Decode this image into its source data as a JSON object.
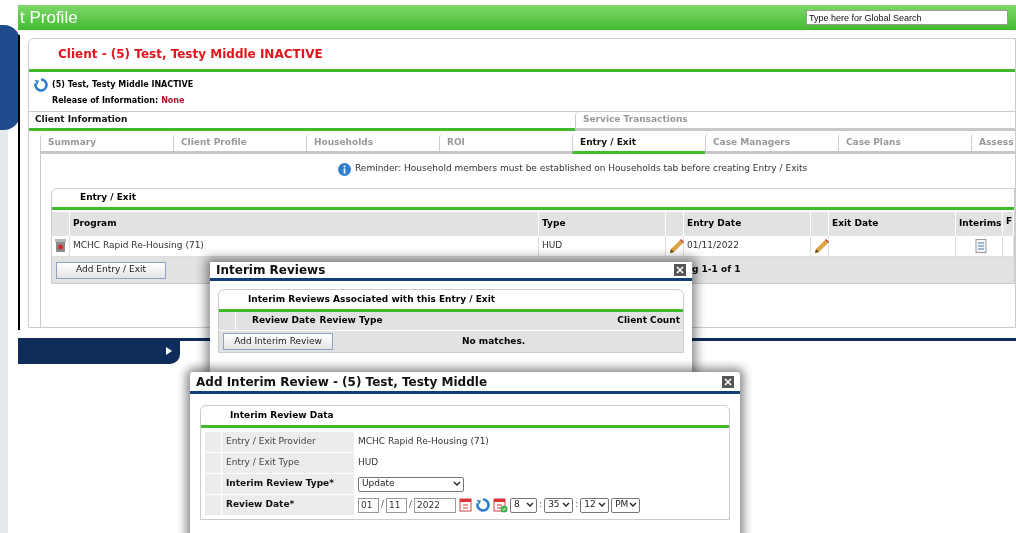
{
  "page_title": "t Profile",
  "global_search": {
    "placeholder": "Type here for Global Search"
  },
  "client_header": "Client - (5) Test, Testy Middle INACTIVE",
  "client_name": "(5) Test, Testy Middle INACTIVE",
  "release_of_information": {
    "label": "Release of Information:",
    "value": "None"
  },
  "section_tabs": [
    {
      "label": "Client Information",
      "selected": true
    },
    {
      "label": "Service Transactions",
      "selected": false
    }
  ],
  "sub_tabs": [
    {
      "label": "Summary",
      "selected": false
    },
    {
      "label": "Client Profile",
      "selected": false
    },
    {
      "label": "Households",
      "selected": false
    },
    {
      "label": "ROI",
      "selected": false
    },
    {
      "label": "Entry / Exit",
      "selected": true
    },
    {
      "label": "Case Managers",
      "selected": false
    },
    {
      "label": "Case Plans",
      "selected": false
    },
    {
      "label": "Assess",
      "selected": false
    }
  ],
  "reminder": "Reminder: Household members must be established on Households tab before creating Entry / Exits",
  "entry_exit": {
    "title": "Entry / Exit",
    "columns": [
      "Program",
      "Type",
      "Entry Date",
      "Exit Date",
      "Interims",
      "F"
    ],
    "rows": [
      {
        "program": "MCHC Rapid Re-Housing (71)",
        "type": "HUD",
        "entry_date": "01/11/2022",
        "exit_date": ""
      }
    ],
    "add_button": "Add Entry / Exit",
    "pager": "g 1-1 of 1"
  },
  "interim_reviews_dialog": {
    "title": "Interim Reviews",
    "section_title": "Interim Reviews Associated with this Entry / Exit",
    "columns": [
      "Review Date",
      "Review Type",
      "Client Count"
    ],
    "add_button": "Add Interim Review",
    "empty_text": "No matches."
  },
  "add_interim_review_dialog": {
    "title": "Add Interim Review - (5) Test, Testy Middle",
    "section_title": "Interim Review Data",
    "fields": [
      {
        "kind": "text",
        "label": "Entry / Exit Provider",
        "required": false,
        "value": "MCHC Rapid Re-Housing (71)"
      },
      {
        "kind": "text",
        "label": "Entry / Exit Type",
        "required": false,
        "value": "HUD"
      },
      {
        "kind": "select",
        "label": "Interim Review Type*",
        "required": true,
        "value": "Update"
      },
      {
        "kind": "datetime",
        "label": "Review Date*",
        "required": true,
        "parts": [
          {
            "kind": "input",
            "value": "01"
          },
          {
            "kind": "sep",
            "value": "/"
          },
          {
            "kind": "input",
            "value": "11"
          },
          {
            "kind": "sep",
            "value": "/"
          },
          {
            "kind": "input",
            "value": "2022"
          },
          {
            "kind": "calendar"
          },
          {
            "kind": "refresh"
          },
          {
            "kind": "calendar-check"
          },
          {
            "kind": "select",
            "value": "8"
          },
          {
            "kind": "sep",
            "value": ":"
          },
          {
            "kind": "select",
            "value": "35"
          },
          {
            "kind": "sep",
            "value": ":"
          },
          {
            "kind": "select",
            "value": "12"
          },
          {
            "kind": "select",
            "value": "PM"
          }
        ]
      }
    ]
  }
}
